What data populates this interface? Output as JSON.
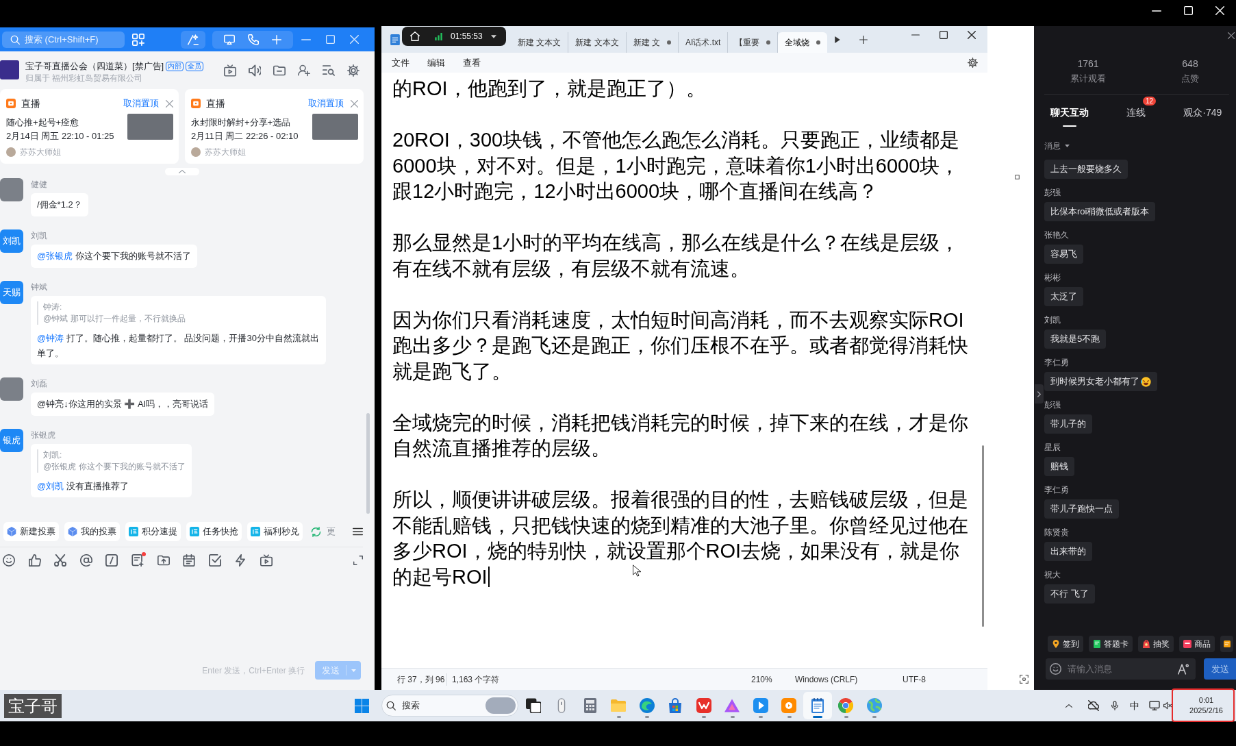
{
  "chat_window": {
    "search": {
      "placeholder": "搜索 (Ctrl+Shift+F)"
    },
    "group": {
      "name": "宝子哥直播公会（四道菜）[禁广告]",
      "tags": [
        "内部",
        "全员"
      ],
      "owner": "归属于 福州彩虹岛贸易有限公司"
    },
    "pinned": [
      {
        "type": "直播",
        "action": "取消置顶",
        "title": "随心推+起号+痊愈",
        "time": "2月14日 周五 22:10 - 01:25",
        "host": "苏苏大师姐"
      },
      {
        "type": "直播",
        "action": "取消置顶",
        "title": "永封限时解封+分享+选品",
        "time": "2月11日 周二 22:26 - 02:10",
        "host": "苏苏大师姐"
      }
    ],
    "messages": [
      {
        "sender": "健健",
        "avatar": {
          "kind": "photo"
        },
        "text": "/佣金*1.2？"
      },
      {
        "sender": "刘凯",
        "avatar": {
          "kind": "label",
          "label": "刘凯"
        },
        "mention": "@张银虎",
        "text": "你这个要下我的账号就不活了"
      },
      {
        "sender": "钟斌",
        "avatar": {
          "kind": "label",
          "label": "天赐"
        },
        "quote": {
          "author": "钟涛:",
          "text": "@钟斌 那可以打一件起量，不行就换品"
        },
        "mention": "@钟涛",
        "text": "打了。随心推，起量都打了。 品没问题，开播30分中自然流就出单了。"
      },
      {
        "sender": "刘磊",
        "avatar": {
          "kind": "photo"
        },
        "text": "@钟亮↓你这用的实景 ➕ AI吗，，亮哥说话"
      },
      {
        "sender": "张银虎",
        "avatar": {
          "kind": "label",
          "label": "银虎"
        },
        "quote": {
          "author": "刘凯:",
          "text": "@张银虎 你这个要下我的账号就不活了"
        },
        "mention": "@刘凯",
        "text": "没有直播推荐了"
      }
    ],
    "quick_actions": [
      {
        "kind": "vote",
        "label": "新建投票"
      },
      {
        "kind": "vote",
        "label": "我的投票"
      },
      {
        "kind": "app",
        "label": "积分速提"
      },
      {
        "kind": "app",
        "label": "任务快抢"
      },
      {
        "kind": "app",
        "label": "福利秒兑"
      },
      {
        "kind": "refresh",
        "label": "更"
      }
    ],
    "composer": {
      "tools": [
        {
          "kind": "emoji",
          "dot": false
        },
        {
          "kind": "like",
          "dot": false
        },
        {
          "kind": "scissors",
          "dot": false
        },
        {
          "kind": "at",
          "dot": false
        },
        {
          "kind": "slash",
          "dot": false
        },
        {
          "kind": "doc",
          "dot": true
        },
        {
          "kind": "upload",
          "dot": false
        },
        {
          "kind": "card",
          "dot": false
        },
        {
          "kind": "check",
          "dot": false
        },
        {
          "kind": "flash",
          "dot": false
        },
        {
          "kind": "tv",
          "dot": false
        }
      ],
      "hint": "Enter 发送，Ctrl+Enter 换行",
      "send": {
        "label": "发送",
        "disabled": true
      }
    }
  },
  "recorder": {
    "time": "01:55:53"
  },
  "notepad": {
    "tabs": [
      {
        "label": "新建 文本文",
        "selected": false,
        "modified": false
      },
      {
        "label": "新建 文本文",
        "selected": false,
        "modified": false
      },
      {
        "label": "新建 文",
        "selected": false,
        "modified": true
      },
      {
        "label": "AI话术.txt",
        "selected": false,
        "modified": false
      },
      {
        "label": "【重要",
        "selected": false,
        "modified": true
      },
      {
        "label": "全域烧",
        "selected": true,
        "modified": true
      }
    ],
    "menu": [
      "文件",
      "编辑",
      "查看"
    ],
    "paragraphs": [
      [
        "的ROI，他跑到了，就是跑正了）。"
      ],
      [
        "20ROI，300块钱，不管他怎么跑怎么消耗。只要跑正，业绩都是",
        "6000块，对不对。但是，1小时跑完，意味着你1小时出6000块，",
        "跟12小时跑完，12小时出6000块，哪个直播间在线高？"
      ],
      [
        "那么显然是1小时的平均在线高，那么在线是什么？在线是层级，",
        "有在线不就有层级，有层级不就有流速。"
      ],
      [
        "因为你们只看消耗速度，太怕短时间高消耗，而不去观察实际ROI",
        "跑出多少？是跑飞还是跑正，你们压根不在乎。或者都觉得消耗快",
        "就是跑飞了。"
      ],
      [
        "全域烧完的时候，消耗把钱消耗完的时候，掉下来的在线，才是你",
        "自然流直播推荐的层级。"
      ],
      [
        "所以，顺便讲讲破层级。报着很强的目的性，去赔钱破层级，但是",
        "不能乱赔钱，只把钱快速的烧到精准的大池子里。你曾经见过他在",
        "多少ROI，烧的特别快，就设置那个ROI去烧，如果没有，就是你",
        "的起号ROI"
      ]
    ],
    "caret": true,
    "status": {
      "position": "行 37，列 96",
      "chars": "1,163 个字符",
      "zoom": "210%",
      "line_ending": "Windows (CRLF)",
      "encoding": "UTF-8"
    }
  },
  "live_panel": {
    "stats": [
      {
        "value": "1761",
        "label": "累计观看"
      },
      {
        "value": "648",
        "label": "点赞"
      }
    ],
    "tabs": [
      {
        "label": "聊天互动",
        "selected": true
      },
      {
        "label": "连线",
        "selected": false,
        "badge": "12"
      },
      {
        "label": "观众·749",
        "selected": false
      }
    ],
    "filter": "消息",
    "comments": [
      {
        "text": "上去一般要烧多久",
        "emoji": false
      },
      {
        "user": "彭强",
        "text": "比保本roi稍微低或者版本",
        "emoji": false
      },
      {
        "user": "张艳久",
        "text": "容易飞",
        "emoji": false
      },
      {
        "user": "彬彬",
        "text": "太泛了",
        "emoji": false
      },
      {
        "user": "刘凯",
        "text": "我就是5不跑",
        "emoji": false
      },
      {
        "user": "李仁勇",
        "text": "到时候男女老小都有了",
        "emoji": true
      },
      {
        "user": "彭强",
        "text": "带儿子的",
        "emoji": false
      },
      {
        "user": "星辰",
        "text": "赔钱",
        "emoji": false
      },
      {
        "user": "李仁勇",
        "text": "带儿子跑快一点",
        "emoji": false
      },
      {
        "user": "陈贤贵",
        "text": "出来带的",
        "emoji": false
      },
      {
        "user": "祝大",
        "text": "不行 飞了",
        "emoji": false
      }
    ],
    "tools": [
      {
        "kind": "checkin",
        "label": "签到"
      },
      {
        "kind": "quiz",
        "label": "答题卡"
      },
      {
        "kind": "lottery",
        "label": "抽奖"
      },
      {
        "kind": "goods",
        "label": "商品"
      },
      {
        "kind": "more"
      }
    ],
    "input": {
      "placeholder": "请输入消息"
    },
    "send": "发送"
  },
  "taskbar": {
    "search": {
      "placeholder": "搜索"
    },
    "apps": [
      {
        "kind": "taskview",
        "running": false,
        "active": false
      },
      {
        "kind": "device",
        "running": false,
        "active": false
      },
      {
        "kind": "calculator",
        "running": false,
        "active": false
      },
      {
        "kind": "explorer",
        "running": true,
        "active": false
      },
      {
        "kind": "edge",
        "running": true,
        "active": false
      },
      {
        "kind": "store",
        "running": false,
        "active": false
      },
      {
        "kind": "wps",
        "running": true,
        "active": false
      },
      {
        "kind": "triangle",
        "running": true,
        "active": false
      },
      {
        "kind": "arrowapp",
        "running": true,
        "active": false
      },
      {
        "kind": "recorder",
        "running": true,
        "active": false
      },
      {
        "kind": "notepad",
        "running": true,
        "active": true
      },
      {
        "kind": "chrome",
        "running": true,
        "active": false
      },
      {
        "kind": "globe",
        "running": true,
        "active": false
      }
    ],
    "ime": "中",
    "clock": {
      "time": "0:01",
      "date": "2025/2/16"
    }
  },
  "overlay_label": "宝子哥"
}
